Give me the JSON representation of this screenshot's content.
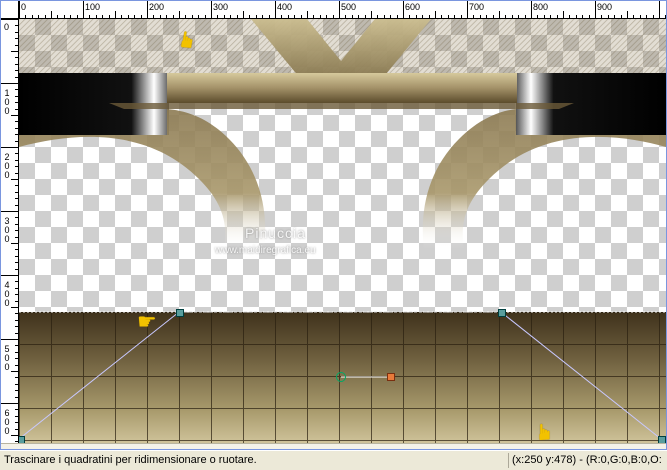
{
  "rulers": {
    "horizontal_labels": [
      "0",
      "100",
      "200",
      "300",
      "400",
      "500",
      "600",
      "700",
      "800",
      "900"
    ],
    "vertical_labels": [
      "0",
      "100",
      "200",
      "300",
      "400",
      "500",
      "600"
    ]
  },
  "watermark": {
    "line1": "Pinuccia",
    "line2": "www.maidiregrafica.eu"
  },
  "icons": {
    "pointer_hand": "pointing-hand-icon",
    "rotation_handle": "rotation-handle-icon"
  },
  "colors": {
    "gold_dark": "#4a3c22",
    "gold_mid": "#8c7a52",
    "gold_light": "#c7b98a",
    "handle_color": "#e87a3a"
  },
  "status": {
    "message": "Trascinare i quadratini per ridimensionare o ruotare.",
    "coords": "(x:250 y:478) - (R:0,G:0,B:0,O:"
  }
}
